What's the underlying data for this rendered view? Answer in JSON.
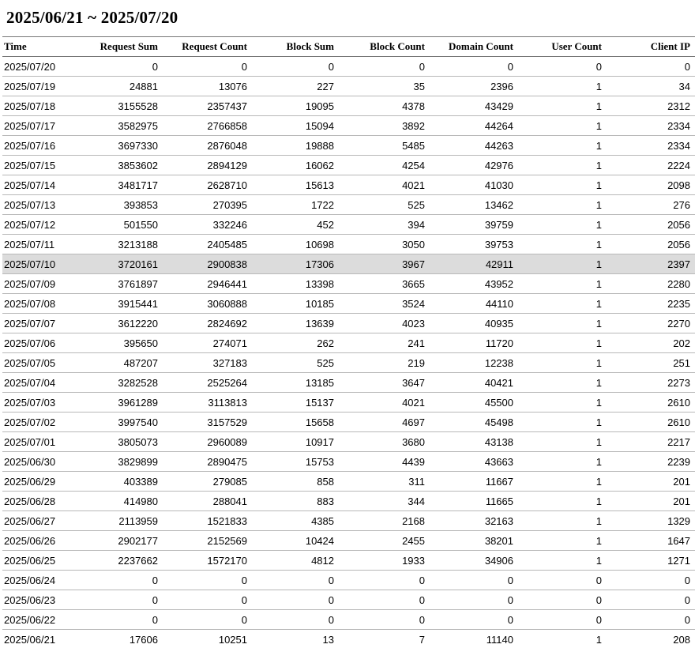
{
  "title": "2025/06/21 ~ 2025/07/20",
  "columns": [
    "Time",
    "Request Sum",
    "Request Count",
    "Block Sum",
    "Block Count",
    "Domain Count",
    "User Count",
    "Client IP"
  ],
  "highlight_row": 10,
  "rows": [
    [
      "2025/07/20",
      "0",
      "0",
      "0",
      "0",
      "0",
      "0",
      "0"
    ],
    [
      "2025/07/19",
      "24881",
      "13076",
      "227",
      "35",
      "2396",
      "1",
      "34"
    ],
    [
      "2025/07/18",
      "3155528",
      "2357437",
      "19095",
      "4378",
      "43429",
      "1",
      "2312"
    ],
    [
      "2025/07/17",
      "3582975",
      "2766858",
      "15094",
      "3892",
      "44264",
      "1",
      "2334"
    ],
    [
      "2025/07/16",
      "3697330",
      "2876048",
      "19888",
      "5485",
      "44263",
      "1",
      "2334"
    ],
    [
      "2025/07/15",
      "3853602",
      "2894129",
      "16062",
      "4254",
      "42976",
      "1",
      "2224"
    ],
    [
      "2025/07/14",
      "3481717",
      "2628710",
      "15613",
      "4021",
      "41030",
      "1",
      "2098"
    ],
    [
      "2025/07/13",
      "393853",
      "270395",
      "1722",
      "525",
      "13462",
      "1",
      "276"
    ],
    [
      "2025/07/12",
      "501550",
      "332246",
      "452",
      "394",
      "39759",
      "1",
      "2056"
    ],
    [
      "2025/07/11",
      "3213188",
      "2405485",
      "10698",
      "3050",
      "39753",
      "1",
      "2056"
    ],
    [
      "2025/07/10",
      "3720161",
      "2900838",
      "17306",
      "3967",
      "42911",
      "1",
      "2397"
    ],
    [
      "2025/07/09",
      "3761897",
      "2946441",
      "13398",
      "3665",
      "43952",
      "1",
      "2280"
    ],
    [
      "2025/07/08",
      "3915441",
      "3060888",
      "10185",
      "3524",
      "44110",
      "1",
      "2235"
    ],
    [
      "2025/07/07",
      "3612220",
      "2824692",
      "13639",
      "4023",
      "40935",
      "1",
      "2270"
    ],
    [
      "2025/07/06",
      "395650",
      "274071",
      "262",
      "241",
      "11720",
      "1",
      "202"
    ],
    [
      "2025/07/05",
      "487207",
      "327183",
      "525",
      "219",
      "12238",
      "1",
      "251"
    ],
    [
      "2025/07/04",
      "3282528",
      "2525264",
      "13185",
      "3647",
      "40421",
      "1",
      "2273"
    ],
    [
      "2025/07/03",
      "3961289",
      "3113813",
      "15137",
      "4021",
      "45500",
      "1",
      "2610"
    ],
    [
      "2025/07/02",
      "3997540",
      "3157529",
      "15658",
      "4697",
      "45498",
      "1",
      "2610"
    ],
    [
      "2025/07/01",
      "3805073",
      "2960089",
      "10917",
      "3680",
      "43138",
      "1",
      "2217"
    ],
    [
      "2025/06/30",
      "3829899",
      "2890475",
      "15753",
      "4439",
      "43663",
      "1",
      "2239"
    ],
    [
      "2025/06/29",
      "403389",
      "279085",
      "858",
      "311",
      "11667",
      "1",
      "201"
    ],
    [
      "2025/06/28",
      "414980",
      "288041",
      "883",
      "344",
      "11665",
      "1",
      "201"
    ],
    [
      "2025/06/27",
      "2113959",
      "1521833",
      "4385",
      "2168",
      "32163",
      "1",
      "1329"
    ],
    [
      "2025/06/26",
      "2902177",
      "2152569",
      "10424",
      "2455",
      "38201",
      "1",
      "1647"
    ],
    [
      "2025/06/25",
      "2237662",
      "1572170",
      "4812",
      "1933",
      "34906",
      "1",
      "1271"
    ],
    [
      "2025/06/24",
      "0",
      "0",
      "0",
      "0",
      "0",
      "0",
      "0"
    ],
    [
      "2025/06/23",
      "0",
      "0",
      "0",
      "0",
      "0",
      "0",
      "0"
    ],
    [
      "2025/06/22",
      "0",
      "0",
      "0",
      "0",
      "0",
      "0",
      "0"
    ],
    [
      "2025/06/21",
      "17606",
      "10251",
      "13",
      "7",
      "11140",
      "1",
      "208"
    ]
  ]
}
